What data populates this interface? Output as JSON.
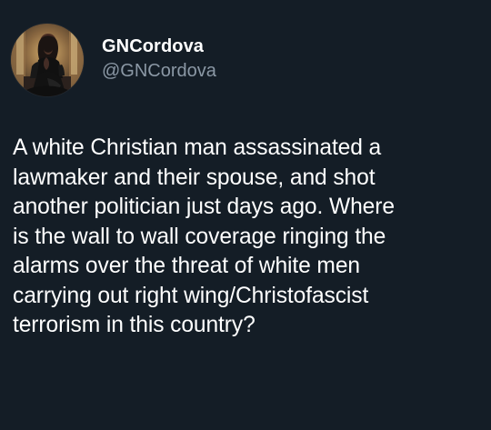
{
  "tweet": {
    "author": {
      "display_name": "GNCordova",
      "handle": "@GNCordova",
      "avatar_icon": "profile-avatar"
    },
    "text": "A white Christian man assassinated a\nlawmaker and their spouse, and shot\nanother politician just days ago. Where\nis the wall to wall coverage ringing the\nalarms over the threat of white men\ncarrying out right wing/Christofascist\nterrorism in this country?"
  },
  "colors": {
    "background": "#141d26",
    "text_primary": "#ffffff",
    "text_secondary": "#8b98a5"
  }
}
